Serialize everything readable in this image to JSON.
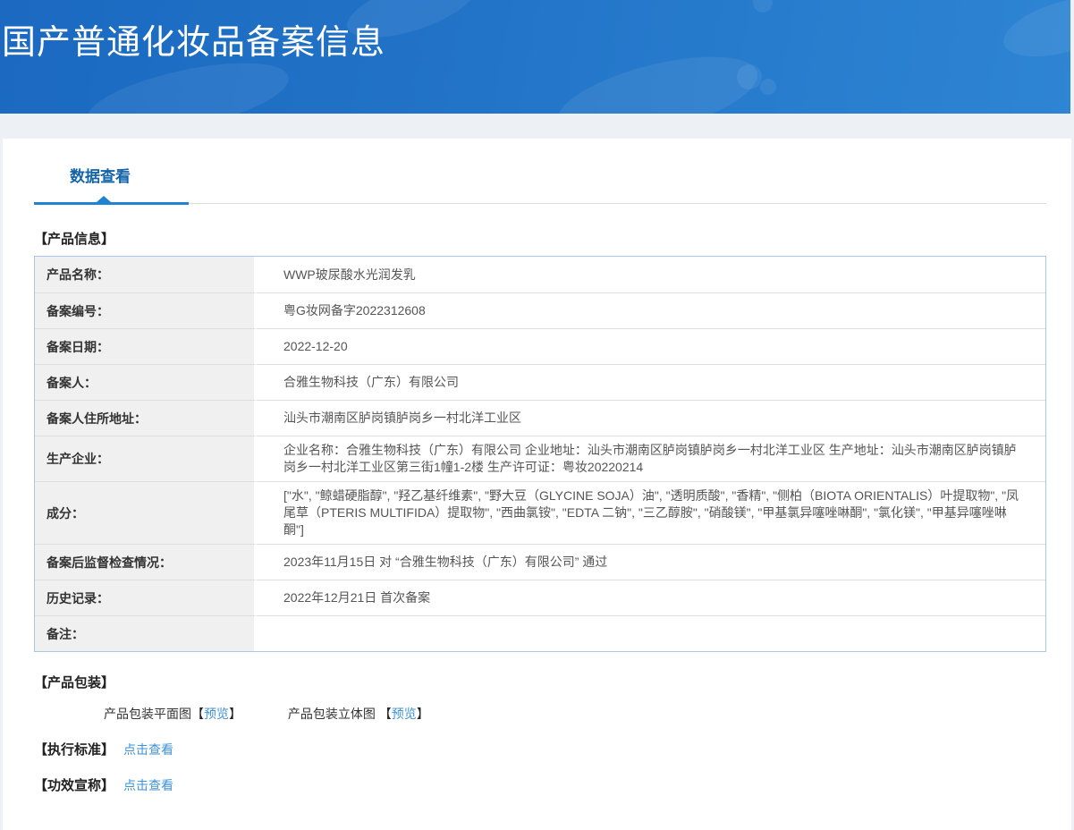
{
  "header": {
    "title": "国产普通化妆品备案信息"
  },
  "tabs": {
    "data_view_label": "数据查看"
  },
  "product_info": {
    "section_title": "【产品信息】",
    "rows": [
      {
        "label": "产品名称：",
        "value": "WWP玻尿酸水光润发乳"
      },
      {
        "label": "备案编号：",
        "value": "粤G妆网备字2022312608"
      },
      {
        "label": "备案日期：",
        "value": "2022-12-20"
      },
      {
        "label": "备案人：",
        "value": "合雅生物科技（广东）有限公司"
      },
      {
        "label": "备案人住所地址：",
        "value": "汕头市潮南区胪岗镇胪岗乡一村北洋工业区"
      },
      {
        "label": "生产企业：",
        "value": "企业名称：合雅生物科技（广东）有限公司 企业地址：汕头市潮南区胪岗镇胪岗乡一村北洋工业区 生产地址：汕头市潮南区胪岗镇胪岗乡一村北洋工业区第三街1幢1-2楼 生产许可证：粤妆20220214"
      },
      {
        "label": "成分：",
        "value": "[\"水\", \"鲸蜡硬脂醇\", \"羟乙基纤维素\", \"野大豆（GLYCINE SOJA）油\", \"透明质酸\", \"香精\", \"侧柏（BIOTA ORIENTALIS）叶提取物\", \"凤尾草（PTERIS MULTIFIDA）提取物\", \"西曲氯铵\", \"EDTA 二钠\", \"三乙醇胺\", \"硝酸镁\", \"甲基氯异噻唑啉酮\", \"氯化镁\", \"甲基异噻唑啉酮\"]"
      },
      {
        "label": "备案后监督检查情况：",
        "value": "2023年11月15日 对 “合雅生物科技（广东）有限公司” 通过"
      },
      {
        "label": "历史记录：",
        "value": "2022年12月21日 首次备案"
      },
      {
        "label": "备注：",
        "value": ""
      }
    ]
  },
  "packaging": {
    "section_title": "【产品包装】",
    "flat_label": "产品包装平面图",
    "flat_bracket_open": "【",
    "flat_link": "预览",
    "flat_bracket_close": "】",
    "solid_label": "产品包装立体图 ",
    "solid_bracket_open": "【",
    "solid_link": "预览",
    "solid_bracket_close": "】"
  },
  "standard": {
    "label": "【执行标准】",
    "link": "点击查看"
  },
  "efficacy": {
    "label": "【功效宣称】",
    "link": "点击查看"
  },
  "colors": {
    "banner_gradient_start": "#1b69c1",
    "banner_gradient_end": "#2e85d3",
    "tab_active_text": "#1464a9",
    "tab_underline": "#1e83d3",
    "link": "#3e92d6",
    "table_border": "#aac7e5",
    "label_cell_bg": "#f0f0f0"
  }
}
